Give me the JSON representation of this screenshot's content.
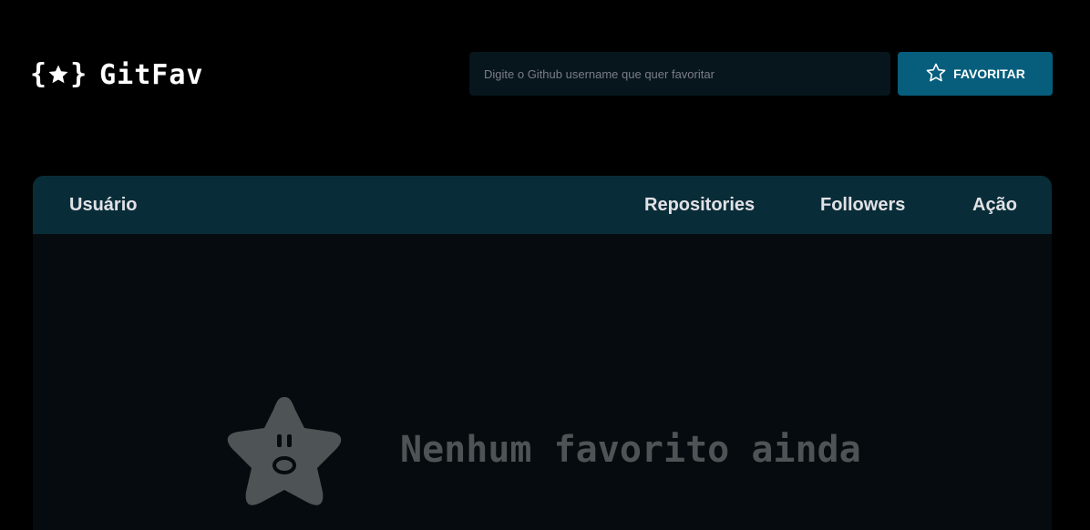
{
  "header": {
    "logo_text": "GitFav",
    "search_placeholder": "Digite o Github username que quer favoritar",
    "favorite_button_label": "FAVORITAR"
  },
  "table": {
    "columns": [
      "Usuário",
      "Repositories",
      "Followers",
      "Ação"
    ],
    "empty_message": "Nenhum favorito ainda"
  },
  "icons": {
    "logo": "star-braces-icon",
    "favorite_button": "star-outline-icon",
    "empty_state": "surprised-star-icon"
  },
  "colors": {
    "background": "#000000",
    "input_bg": "#06161c",
    "button_bg": "#065e7c",
    "table_header_bg": "#092d38",
    "table_body_bg": "#050b0e",
    "empty_text": "#4e5455"
  }
}
